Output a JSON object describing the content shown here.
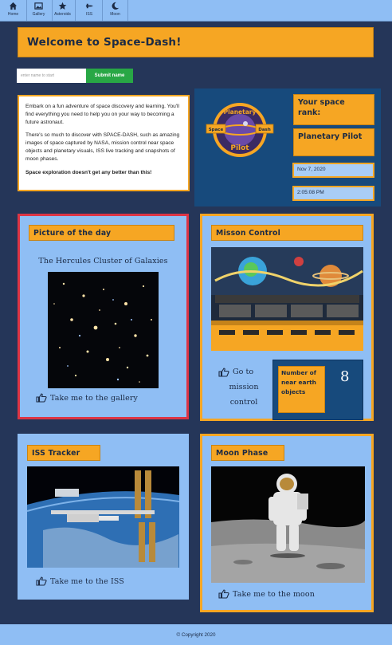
{
  "nav": {
    "items": [
      {
        "label": "Home",
        "icon": "home-icon"
      },
      {
        "label": "Gallery",
        "icon": "image-icon"
      },
      {
        "label": "Asteroids",
        "icon": "star-icon"
      },
      {
        "label": "ISS",
        "icon": "satellite-icon"
      },
      {
        "label": "Moon",
        "icon": "moon-icon"
      }
    ]
  },
  "header": {
    "title": "Welcome to Space-Dash!"
  },
  "name_form": {
    "placeholder": "enter name to start",
    "submit_label": "Submit name"
  },
  "intro": {
    "p1": "Embark on a fun adventure of space discovery and learning. You'll find everything you need to help you on your way to becoming a future astronaut.",
    "p2": "There's so much to discover with SPACE-DASH, such as amazing images of space captured by NASA, mission control near space objects and planetary visuals, ISS live tracking and snapshots of moon phases.",
    "p3": "Space exploration doesn't get any better than this!"
  },
  "rank": {
    "heading": "Your space rank:",
    "value": "Planetary Pilot",
    "date": "Nov 7, 2020",
    "time": "2:05:08 PM",
    "badge": {
      "top_text": "Planetary",
      "bottom_text": "Pilot",
      "left_text": "Space",
      "right_text": "Dash"
    }
  },
  "pod": {
    "title": "Picture of the day",
    "subtitle": "The Hercules Cluster of Galaxies",
    "link": "Take me to the gallery"
  },
  "mission": {
    "title": "Misson Control",
    "link_line1": "Go to",
    "link_line2": "mission",
    "link_line3": "control",
    "neo_label": "Number of near earth objects",
    "neo_value": "8"
  },
  "iss": {
    "title": "ISS Tracker",
    "link": "Take me to the ISS"
  },
  "moon": {
    "title": "Moon Phase",
    "link": "Take me to the moon"
  },
  "footer": {
    "copyright": "© Copyright 2020"
  },
  "colors": {
    "background": "#253659",
    "nav": "#8fbef4",
    "accent": "#f6a623",
    "panel": "#174a7c",
    "button": "#28a745",
    "highlight_border": "#dc3545"
  }
}
